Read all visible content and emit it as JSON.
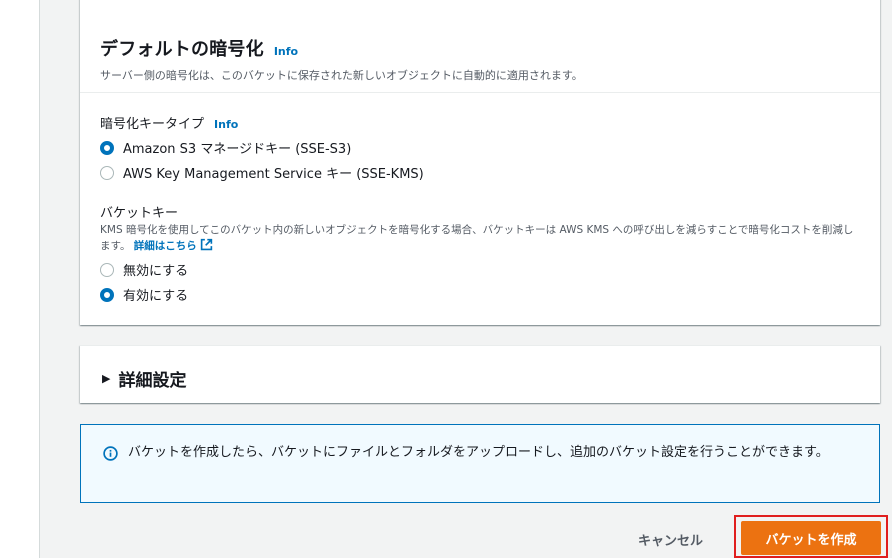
{
  "encryption": {
    "title": "デフォルトの暗号化",
    "info": "Info",
    "description": "サーバー側の暗号化は、このバケットに保存された新しいオブジェクトに自動的に適用されます。",
    "key_type_label": "暗号化キータイプ",
    "key_type_info": "Info",
    "key_type_options": [
      {
        "label": "Amazon S3 マネージドキー (SSE-S3)",
        "selected": true
      },
      {
        "label": "AWS Key Management Service キー (SSE-KMS)",
        "selected": false
      }
    ],
    "bucket_key_label": "バケットキー",
    "bucket_key_description": "KMS 暗号化を使用してこのバケット内の新しいオブジェクトを暗号化する場合、バケットキーは AWS KMS への呼び出しを減らすことで暗号化コストを削減します。",
    "bucket_key_link": "詳細はこちら",
    "bucket_key_options": [
      {
        "label": "無効にする",
        "selected": false
      },
      {
        "label": "有効にする",
        "selected": true
      }
    ]
  },
  "advanced": {
    "title": "詳細設定"
  },
  "alert": {
    "text": "バケットを作成したら、バケットにファイルとフォルダをアップロードし、追加のバケット設定を行うことができます。"
  },
  "footer": {
    "cancel": "キャンセル",
    "create": "バケットを作成"
  },
  "colors": {
    "accent": "#0073bb",
    "primary_button": "#ec7211",
    "highlight": "#e01e1e"
  }
}
